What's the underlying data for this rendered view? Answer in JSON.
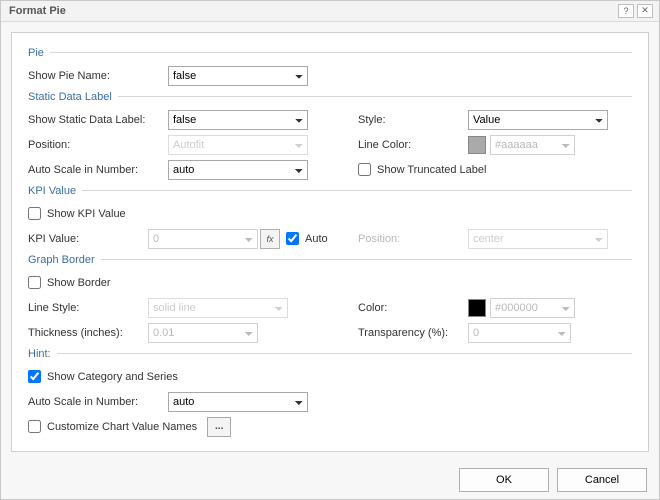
{
  "title": "Format Pie",
  "titlebar": {
    "help": "?",
    "close": "✕"
  },
  "sections": {
    "pie": "Pie",
    "static": "Static Data Label",
    "kpi": "KPI Value",
    "border": "Graph Border",
    "hint": "Hint:"
  },
  "labels": {
    "showPieName": "Show Pie Name:",
    "showStaticDataLabel": "Show Static Data Label:",
    "position": "Position:",
    "autoScaleNumber": "Auto Scale in Number:",
    "style": "Style:",
    "lineColor": "Line Color:",
    "showTruncated": "Show Truncated Label",
    "showKPI": "Show KPI Value",
    "kpiValue": "KPI Value:",
    "auto": "Auto",
    "kpiPosition": "Position:",
    "showBorder": "Show Border",
    "lineStyle": "Line Style:",
    "thickness": "Thickness (inches):",
    "color": "Color:",
    "transparency": "Transparency (%):",
    "showCategorySeries": "Show Category and Series",
    "customizeNames": "Customize Chart Value Names",
    "ellipsis": "...",
    "fx": "fx"
  },
  "values": {
    "showPieName": "false",
    "showStaticDataLabel": "false",
    "position": "Autofit",
    "autoScaleNumber1": "auto",
    "style": "Value",
    "lineColor": "#aaaaaa",
    "lineColorSwatch": "#aaaaaa",
    "kpiValue": "0",
    "kpiPosition": "center",
    "lineStyle": "solid line",
    "thickness": "0.01",
    "color": "#000000",
    "colorSwatch": "#000000",
    "transparency": "0",
    "autoScaleNumber2": "auto"
  },
  "checks": {
    "showTruncated": false,
    "showKPI": false,
    "auto": true,
    "showBorder": false,
    "showCategorySeries": true,
    "customizeNames": false
  },
  "footer": {
    "ok": "OK",
    "cancel": "Cancel"
  }
}
